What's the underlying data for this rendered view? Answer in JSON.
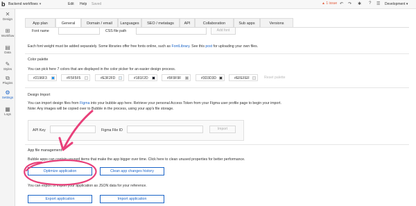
{
  "topbar": {
    "logo": "b",
    "workflow_name": "Backend workflows",
    "menu_edit": "Edit",
    "menu_help": "Help",
    "saved": "Saved",
    "issue_label": "1 issue",
    "environment": "Development"
  },
  "sidebar": {
    "items": [
      {
        "label": "Design",
        "icon": "design-icon"
      },
      {
        "label": "Workflow",
        "icon": "workflow-icon"
      },
      {
        "label": "Data",
        "icon": "database-icon"
      },
      {
        "label": "Styles",
        "icon": "brush-icon"
      },
      {
        "label": "Plugins",
        "icon": "plugin-icon"
      },
      {
        "label": "Settings",
        "icon": "gear-icon",
        "active": true
      },
      {
        "label": "Logs",
        "icon": "logs-icon"
      }
    ]
  },
  "tabs": [
    "App plan",
    "General",
    "Domain / email",
    "Languages",
    "SEO / metatags",
    "API",
    "Collaboration",
    "Sub apps",
    "Versions"
  ],
  "active_tab": "General",
  "fonts": {
    "font_name_label": "Font name",
    "css_path_label": "CSS file path",
    "add_font_btn": "Add font",
    "note_prefix": "Each font weight must be added separately. Some libraries offer free fonts online, such as ",
    "note_link1": "FontLibrary",
    "note_mid": ". See this ",
    "note_link2": "post",
    "note_suffix": " for uploading your own files."
  },
  "palette": {
    "title": "Color palette",
    "description": "You can pick here 7 colors that are displayed in the color picker for an easier design process.",
    "colors": [
      "#2196F3",
      "#F5F5F5",
      "#E3F2FD",
      "#181F2D",
      "#9F9F9F",
      "#3D3D3D",
      "#EFEFEF"
    ],
    "reset_label": "Reset palette"
  },
  "design_import": {
    "title": "Design Import",
    "desc1_prefix": "You can import design files from ",
    "desc1_link": "Figma",
    "desc1_suffix": " into your bubble app here. Retrieve your personal Access Token from your Figma user profile page to begin your import.",
    "desc2": "Note: Any images will be copied over to Bubble in the process, using your app's file storage.",
    "api_key_label": "API Key",
    "figma_file_label": "Figma File ID",
    "import_btn": "Import"
  },
  "file_mgmt": {
    "title": "App file management",
    "description": "Bubble apps can contain unused items that make the app bigger over time. Click here to clean unused properties for better performance.",
    "optimize_btn": "Optimize application",
    "clean_btn": "Clean app changes history",
    "export_desc": "You can export or import your application as JSON data for your reference.",
    "export_btn": "Export application",
    "import_btn": "Import application"
  },
  "colors": {
    "accent": "#1a63c7",
    "annotation": "#e8407a"
  }
}
